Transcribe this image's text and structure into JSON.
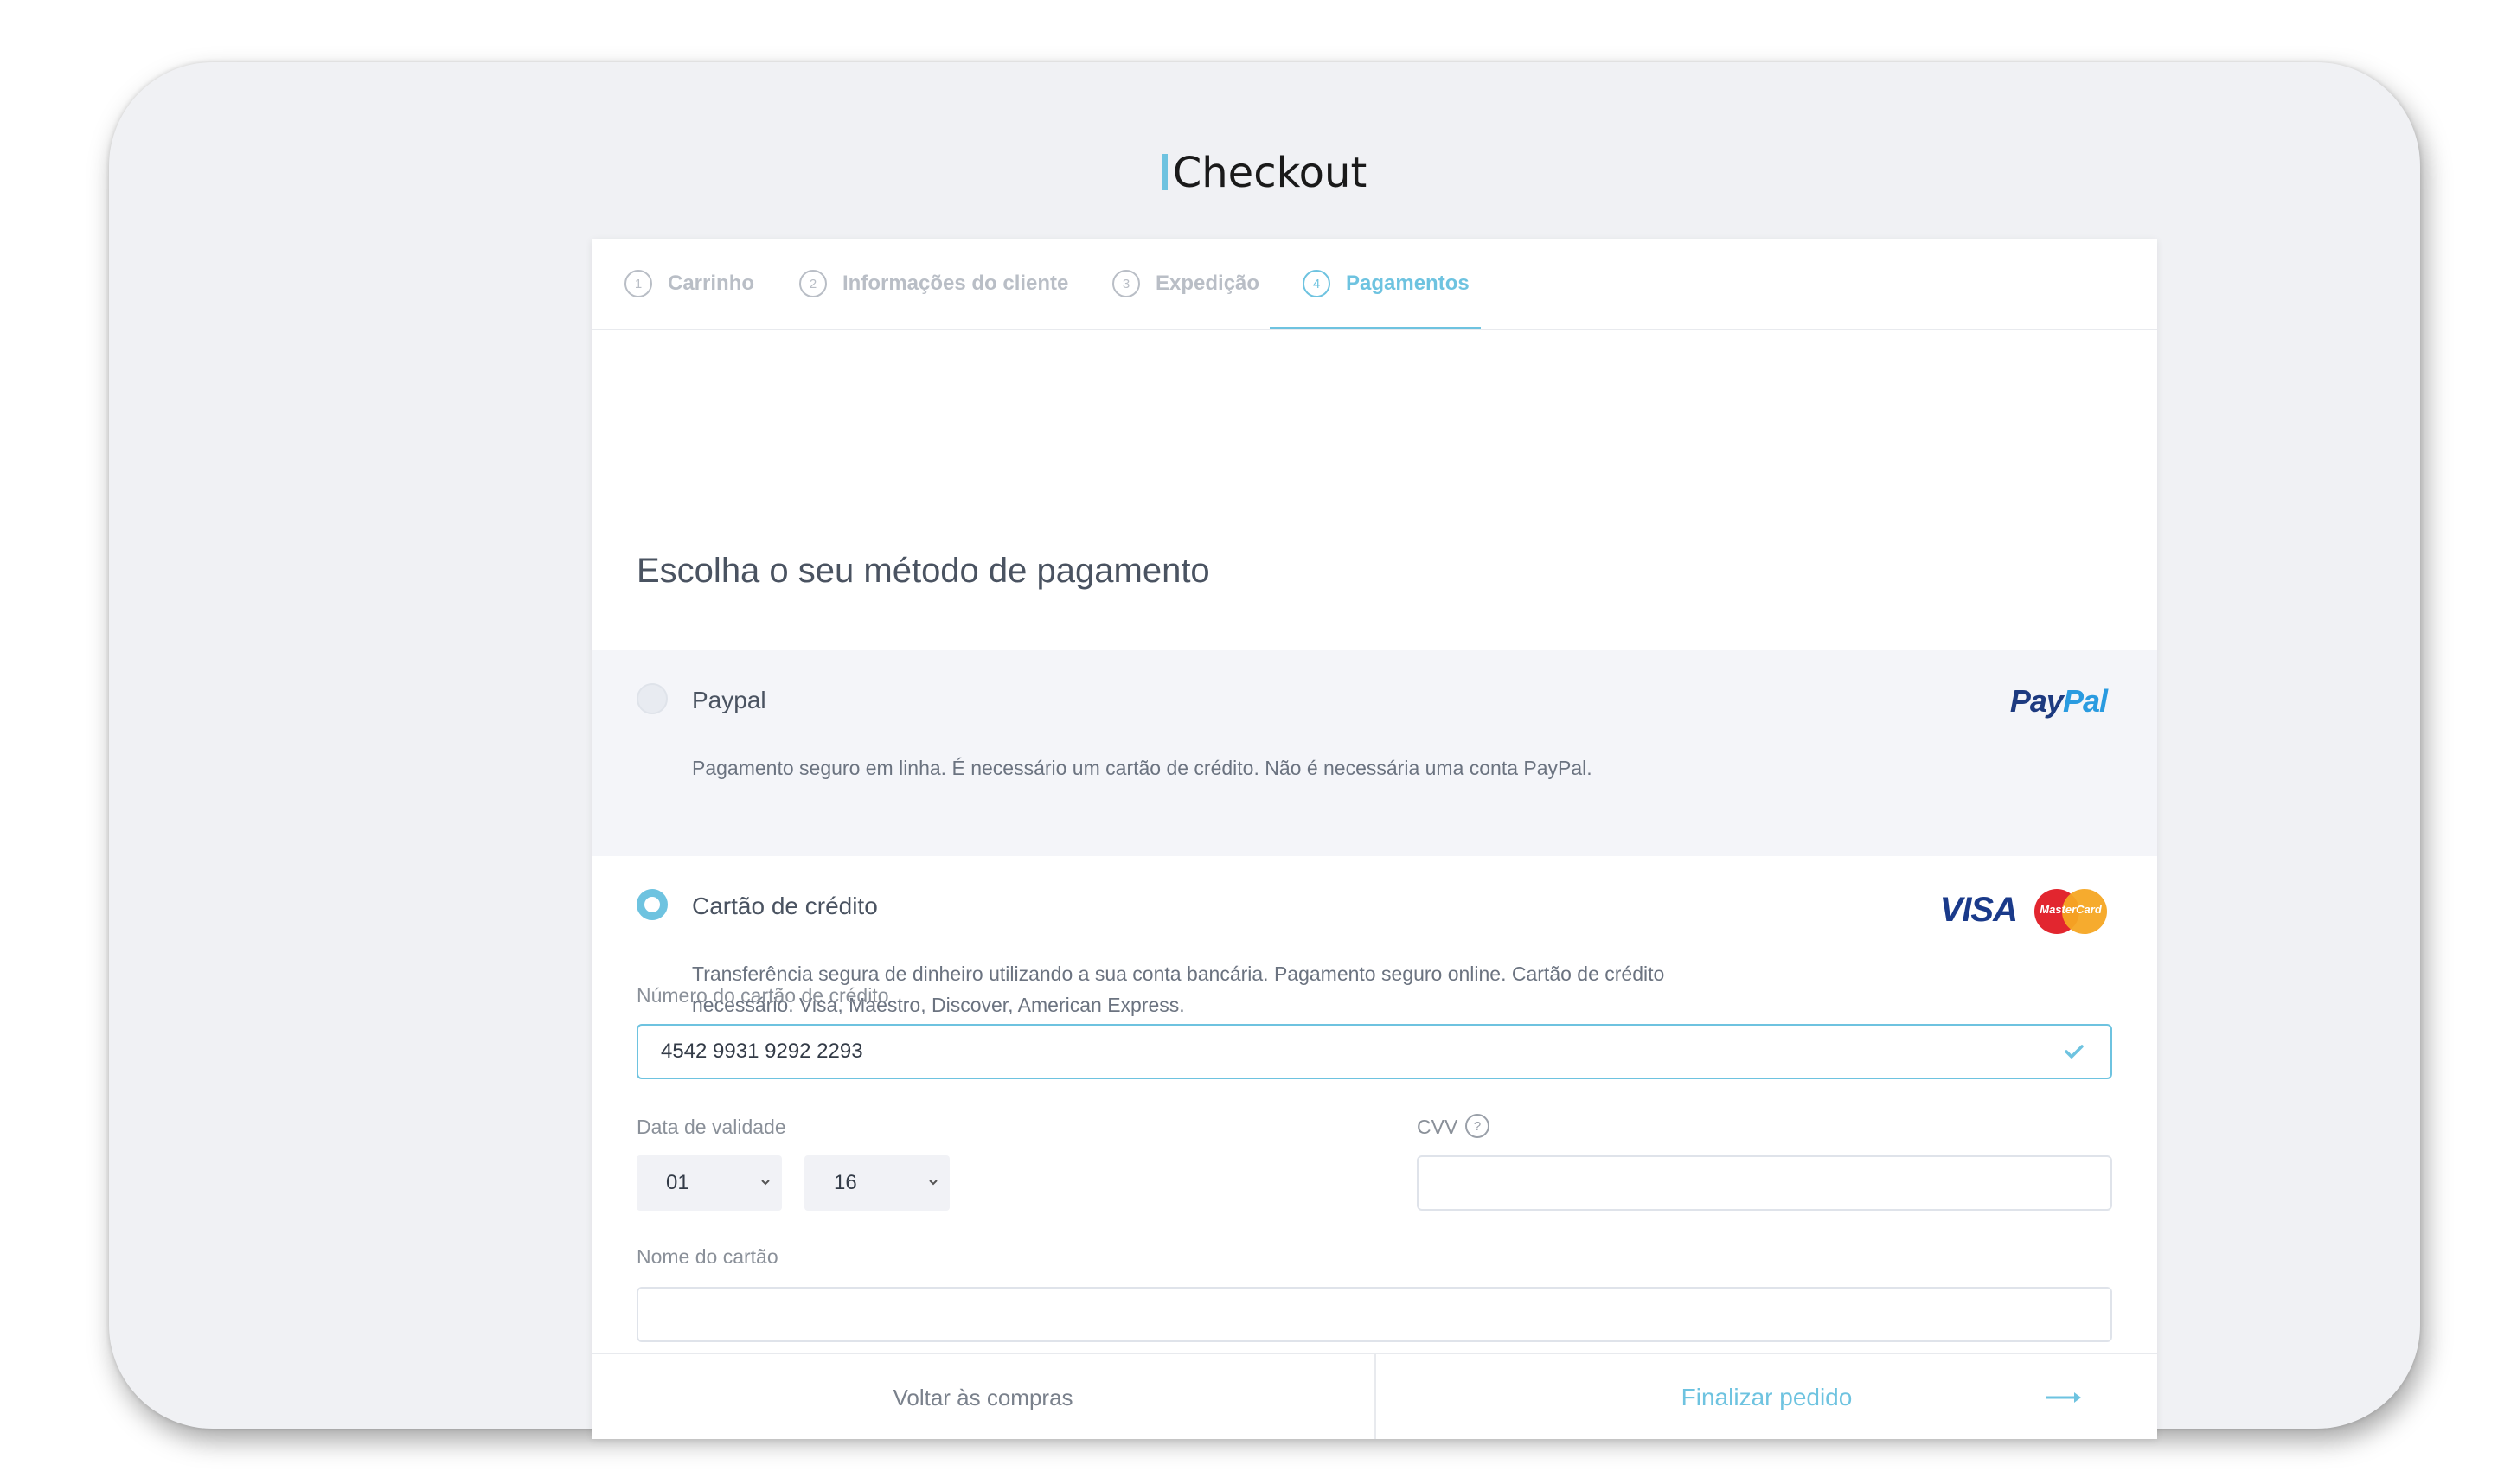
{
  "page": {
    "title": "Checkout"
  },
  "tabs": [
    {
      "num": "1",
      "label": "Carrinho"
    },
    {
      "num": "2",
      "label": "Informações do cliente"
    },
    {
      "num": "3",
      "label": "Expedição"
    },
    {
      "num": "4",
      "label": "Pagamentos"
    }
  ],
  "active_tab": "Pagamentos",
  "heading": "Escolha o seu método de pagamento",
  "methods": {
    "paypal": {
      "label": "Paypal",
      "logo_text_1": "Pay",
      "logo_text_2": "Pal",
      "description": "Pagamento seguro em linha. É necessário um cartão de crédito. Não é necessária uma conta PayPal.",
      "selected": false
    },
    "credit_card": {
      "label": "Cartão de crédito",
      "visa_text": "VISA",
      "mastercard_text": "MasterCard",
      "description_line1": "Transferência segura de dinheiro utilizando a sua conta bancária. Pagamento seguro online. Cartão de crédito",
      "description_line2": "necessário. Visa, Maestro, Discover, American Express.",
      "selected": true
    }
  },
  "form": {
    "card_number_label": "Número do cartão de crédito",
    "card_number_value": "4542 9931 9292 2293",
    "expiry_label": "Data de validade",
    "expiry_month": "01",
    "expiry_year": "16",
    "cvv_label": "CVV",
    "cvv_help": "?",
    "cvv_value": "",
    "card_name_label": "Nome do cartão",
    "card_name_value": ""
  },
  "footer": {
    "back_label": "Voltar às compras",
    "finish_label": "Finalizar pedido"
  },
  "colors": {
    "accent": "#6ec3e0",
    "text_dark": "#4a5361",
    "muted": "#b9bec6"
  }
}
